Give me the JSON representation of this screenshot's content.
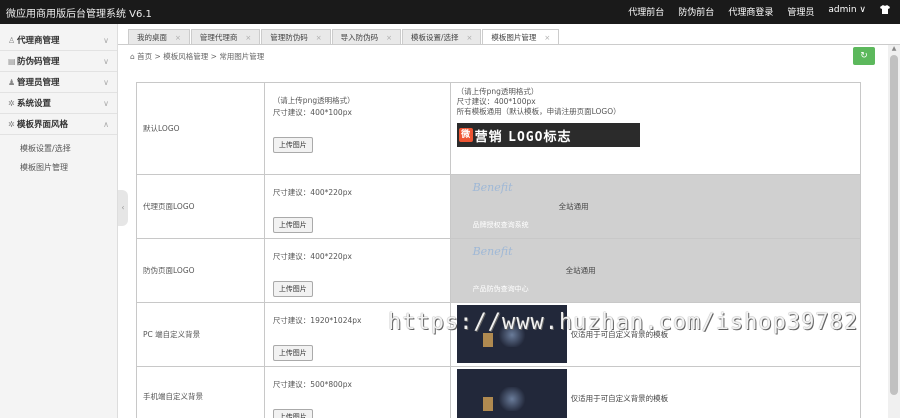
{
  "topbar": {
    "title": "微应用商用版后台管理系统 V6.1",
    "nav": [
      "代理前台",
      "防伪前台",
      "代理商登录",
      "管理员"
    ],
    "user": "admin ∨",
    "shirt_icon": "tshirt-icon"
  },
  "sidebar": {
    "items": [
      {
        "label": "代理商管理",
        "icon": "user-icon"
      },
      {
        "label": "防伪码管理",
        "icon": "doc-icon"
      },
      {
        "label": "管理员管理",
        "icon": "admin-icon"
      },
      {
        "label": "系统设置",
        "icon": "gear-icon"
      },
      {
        "label": "模板界面风格",
        "icon": "gear-icon"
      }
    ],
    "subitems": [
      "模板设置/选择",
      "模板图片管理"
    ]
  },
  "tabs": [
    "我的桌面",
    "管理代理商",
    "管理防伪码",
    "导入防伪码",
    "模板设置/选择",
    "模板图片管理"
  ],
  "breadcrumb": {
    "home": "首页",
    "sep": ">",
    "level1": "模板风格管理",
    "level2": "常用图片管理"
  },
  "rows": [
    {
      "name": "默认LOGO",
      "lines": [
        "（请上传png透明格式）",
        "尺寸建议：400*100px"
      ],
      "button": "上传图片",
      "preview_lines": [
        "（请上传png透明格式）",
        "尺寸建议：400*100px",
        "所有模板通用（默认模板，申请注册页面LOGO）"
      ],
      "logo_mark": "微",
      "logo_text_cn": "营销",
      "logo_text_en": "LOGO",
      "logo_text_tail": "标志"
    },
    {
      "name": "代理页面LOGO",
      "lines": [
        "尺寸建议：400*220px"
      ],
      "button": "上传图片",
      "brand": "Benefit",
      "brand_caption": "品牌授权查询系统",
      "note": "全站通用"
    },
    {
      "name": "防伪页面LOGO",
      "lines": [
        "尺寸建议：400*220px"
      ],
      "button": "上传图片",
      "brand": "Benefit",
      "brand_caption": "产品防伪查询中心",
      "note": "全站通用"
    },
    {
      "name": "PC 端自定义背景",
      "lines": [
        "尺寸建议：1920*1024px"
      ],
      "button": "上传图片",
      "note": "仅适用于可自定义背景的模板"
    },
    {
      "name": "手机端自定义背景",
      "lines": [
        "尺寸建议：500*800px"
      ],
      "button": "上传图片",
      "note": "仅适用于可自定义背景的模板"
    }
  ],
  "watermark": "https://www.huzhan.com/ishop39782"
}
